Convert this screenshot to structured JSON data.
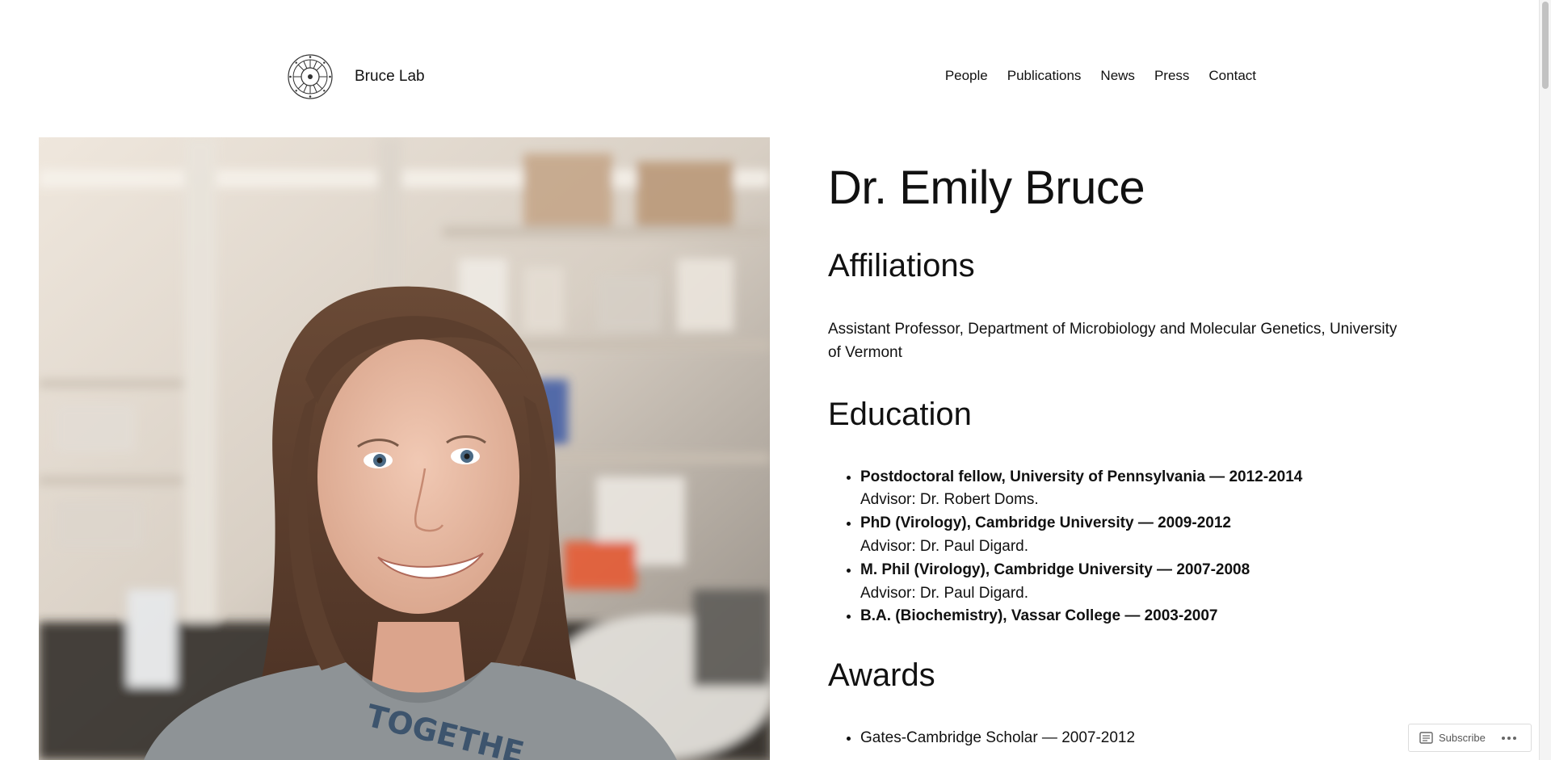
{
  "site": {
    "title": "Bruce Lab",
    "logo_icon": "circular-seal-logo-icon"
  },
  "nav": [
    {
      "label": "People"
    },
    {
      "label": "Publications"
    },
    {
      "label": "News"
    },
    {
      "label": "Press"
    },
    {
      "label": "Contact"
    }
  ],
  "profile": {
    "name": "Dr. Emily Bruce",
    "photo_description_icon": "portrait-photo"
  },
  "affiliations": {
    "heading": "Affiliations",
    "text": "Assistant Professor, Department of Microbiology and Molecular Genetics, University of Vermont"
  },
  "education": {
    "heading": "Education",
    "items": [
      {
        "title": "Postdoctoral fellow, University of Pennsylvania — 2012-2014",
        "advisor": "Advisor: Dr. Robert Doms."
      },
      {
        "title": "PhD (Virology), Cambridge University — 2009-2012",
        "advisor": "Advisor: Dr. Paul Digard."
      },
      {
        "title": "M. Phil (Virology), Cambridge University — 2007-2008",
        "advisor": "Advisor: Dr. Paul Digard."
      },
      {
        "title": "B.A. (Biochemistry), Vassar College — 2003-2007",
        "advisor": ""
      }
    ]
  },
  "awards": {
    "heading": "Awards",
    "items": [
      {
        "text": "Gates-Cambridge Scholar — 2007-2012"
      }
    ]
  },
  "widget": {
    "subscribe_label": "Subscribe",
    "subscribe_icon": "reader-icon",
    "more_icon": "ellipsis-icon"
  },
  "colors": {
    "text": "#111111",
    "background": "#ffffff"
  }
}
